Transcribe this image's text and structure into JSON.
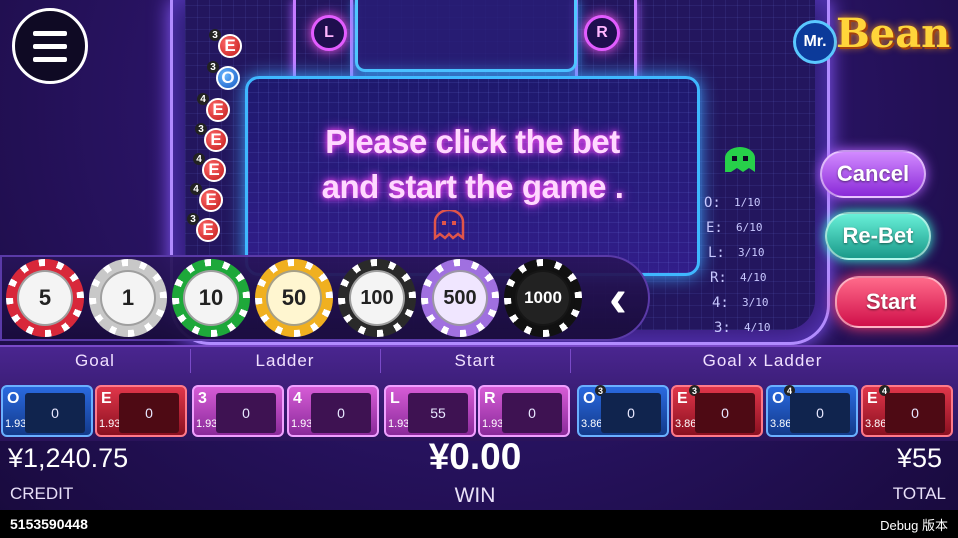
{
  "board": {
    "lanes": [
      "L",
      "R"
    ],
    "message_line1": "Please click the bet",
    "message_line2": "and start the game ."
  },
  "ladder_history": [
    {
      "letter": "E",
      "sup": "3",
      "kind": "e"
    },
    {
      "letter": "O",
      "sup": "3",
      "kind": "o"
    },
    {
      "letter": "E",
      "sup": "4",
      "kind": "e"
    },
    {
      "letter": "E",
      "sup": "3",
      "kind": "e"
    },
    {
      "letter": "E",
      "sup": "4",
      "kind": "e"
    },
    {
      "letter": "E",
      "sup": "4",
      "kind": "e"
    },
    {
      "letter": "E",
      "sup": "3",
      "kind": "e"
    }
  ],
  "stats": [
    {
      "key": "O:",
      "value": "1/10"
    },
    {
      "key": "E:",
      "value": "6/10"
    },
    {
      "key": "L:",
      "value": "3/10"
    },
    {
      "key": "R:",
      "value": "4/10"
    },
    {
      "key": "4:",
      "value": "3/10"
    },
    {
      "key": "3:",
      "value": "4/10"
    }
  ],
  "logo": {
    "mr": "Mr.",
    "bean": "Bean"
  },
  "buttons": {
    "cancel": "Cancel",
    "rebet": "Re-Bet",
    "start": "Start"
  },
  "chips": [
    {
      "value": "5",
      "ring": "#d8283a",
      "face": "#f4f4f4",
      "text": "#222222"
    },
    {
      "value": "1",
      "ring": "#c8c8c8",
      "face": "#f4f4f4",
      "text": "#222222"
    },
    {
      "value": "10",
      "ring": "#1ea83a",
      "face": "#f4f4f4",
      "text": "#222222"
    },
    {
      "value": "50",
      "ring": "#f0b020",
      "face": "#fff6d0",
      "text": "#222222"
    },
    {
      "value": "100",
      "ring": "#2a2a2a",
      "face": "#f4f4f4",
      "text": "#222222"
    },
    {
      "value": "500",
      "ring": "#a070e0",
      "face": "#f0e6ff",
      "text": "#222222"
    },
    {
      "value": "1000",
      "ring": "#111111",
      "face": "#222222",
      "text": "#ffffff"
    }
  ],
  "bet_headers": [
    "Goal",
    "Ladder",
    "Start",
    "Goal x Ladder"
  ],
  "bets": [
    {
      "tag": "O",
      "sup": "",
      "odds": "1.93",
      "value": "0",
      "style": "blue"
    },
    {
      "tag": "E",
      "sup": "",
      "odds": "1.93",
      "value": "0",
      "style": "red"
    },
    {
      "tag": "3",
      "sup": "",
      "odds": "1.93",
      "value": "0",
      "style": "pink"
    },
    {
      "tag": "4",
      "sup": "",
      "odds": "1.93",
      "value": "0",
      "style": "pink"
    },
    {
      "tag": "L",
      "sup": "",
      "odds": "1.93",
      "value": "55",
      "style": "pink"
    },
    {
      "tag": "R",
      "sup": "",
      "odds": "1.93",
      "value": "0",
      "style": "pink"
    },
    {
      "tag": "O",
      "sup": "3",
      "odds": "3.86",
      "value": "0",
      "style": "blue"
    },
    {
      "tag": "E",
      "sup": "3",
      "odds": "3.86",
      "value": "0",
      "style": "red"
    },
    {
      "tag": "O",
      "sup": "4",
      "odds": "3.86",
      "value": "0",
      "style": "blue"
    },
    {
      "tag": "E",
      "sup": "4",
      "odds": "3.86",
      "value": "0",
      "style": "red"
    }
  ],
  "footer": {
    "credit_amount": "¥1,240.75",
    "credit_label": "CREDIT",
    "win_amount": "¥0.00",
    "win_label": "WIN",
    "total_amount": "¥55",
    "total_label": "TOTAL"
  },
  "debug": {
    "id": "5153590448",
    "label": "Debug 版本"
  }
}
